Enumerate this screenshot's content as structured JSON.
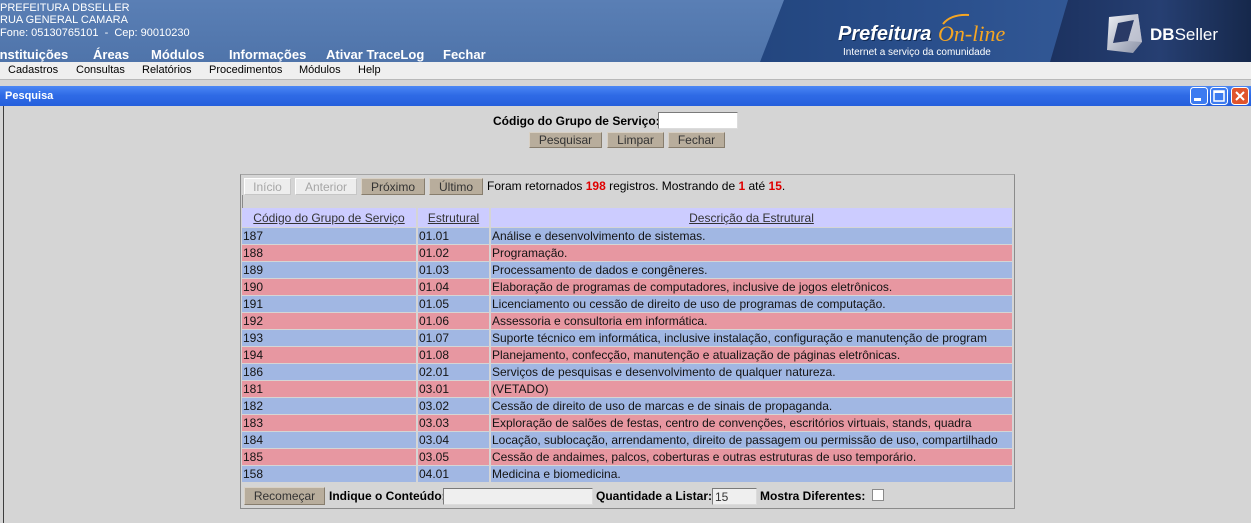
{
  "header": {
    "org_name": "PREFEITURA DBSELLER",
    "address": "RUA GENERAL CAMARA",
    "contact": "Fone: 05130765101  -  Cep: 90010230",
    "menu": [
      "Instituições",
      "Áreas",
      "Módulos",
      "Informações",
      "Ativar TraceLog",
      "Fechar"
    ],
    "banner": {
      "brand": "Prefeitura",
      "brand_accent": "On-line",
      "tagline": "Internet a serviço da comunidade"
    },
    "vendor": {
      "prefix": "DB",
      "suffix": "Seller"
    }
  },
  "menubar": [
    "Cadastros",
    "Consultas",
    "Relatórios",
    "Procedimentos",
    "Módulos",
    "Help"
  ],
  "window": {
    "title": "Pesquisa",
    "control_icons": [
      "minimize-icon",
      "maximize-icon",
      "close-icon"
    ]
  },
  "search": {
    "label": "Código do Grupo de Serviço:",
    "value": "",
    "buttons": {
      "search": "Pesquisar",
      "clear": "Limpar",
      "close": "Fechar"
    }
  },
  "results": {
    "pager": {
      "first": "Início",
      "previous": "Anterior",
      "next": "Próximo",
      "last": "Último"
    },
    "pager_disabled": [
      "first",
      "previous"
    ],
    "summary": {
      "prefix": "Foram retornados ",
      "total": "198",
      "middle": " registros. Mostrando de ",
      "from": "1",
      "to_label": " até ",
      "to": "15",
      "suffix": "."
    },
    "columns": [
      "Código do Grupo de Serviço",
      "Estrutural",
      "Descrição da Estrutural"
    ],
    "rows": [
      {
        "code": "187",
        "structural": "01.01",
        "description": "Análise e desenvolvimento de sistemas."
      },
      {
        "code": "188",
        "structural": "01.02",
        "description": "Programação."
      },
      {
        "code": "189",
        "structural": "01.03",
        "description": "Processamento de dados e congêneres."
      },
      {
        "code": "190",
        "structural": "01.04",
        "description": "Elaboração de programas de computadores, inclusive de jogos eletrônicos."
      },
      {
        "code": "191",
        "structural": "01.05",
        "description": "Licenciamento ou cessão de direito de uso de programas de computação."
      },
      {
        "code": "192",
        "structural": "01.06",
        "description": "Assessoria e consultoria em informática."
      },
      {
        "code": "193",
        "structural": "01.07",
        "description": "Suporte técnico em informática, inclusive instalação, configuração e manutenção de program"
      },
      {
        "code": "194",
        "structural": "01.08",
        "description": "Planejamento, confecção, manutenção e atualização de páginas eletrônicas."
      },
      {
        "code": "186",
        "structural": "02.01",
        "description": "Serviços de pesquisas e desenvolvimento de qualquer natureza."
      },
      {
        "code": "181",
        "structural": "03.01",
        "description": "(VETADO)"
      },
      {
        "code": "182",
        "structural": "03.02",
        "description": "Cessão de direito de uso de marcas e de sinais de propaganda."
      },
      {
        "code": "183",
        "structural": "03.03",
        "description": "Exploração de salões de festas, centro de convenções, escritórios virtuais, stands, quadra"
      },
      {
        "code": "184",
        "structural": "03.04",
        "description": "Locação, sublocação, arrendamento, direito de passagem ou permissão de uso, compartilhado"
      },
      {
        "code": "185",
        "structural": "03.05",
        "description": "Cessão de andaimes, palcos, coberturas e outras estruturas de uso temporário."
      },
      {
        "code": "158",
        "structural": "04.01",
        "description": "Medicina e biomedicina."
      }
    ]
  },
  "footer": {
    "restart": "Recomeçar",
    "filter_label": "Indique o Conteúdo:",
    "filter_value": "",
    "qty_label": "Quantidade a Listar:",
    "qty_value": "15",
    "distinct_label": "Mostra Diferentes:",
    "distinct_checked": false
  },
  "colors": {
    "header_blue": "#4f74aa",
    "banner_blue": "#2a4f8c",
    "vendor_navy": "#1c3260",
    "brand_accent": "#f6a623",
    "titlebar_blue": "#2f6be6",
    "window_bg": "#d5d5d5",
    "button_tan": "#b8ad9c",
    "header_row": "#ccccff",
    "row_blue": "#a1b7e3",
    "row_pink": "#e797a1",
    "highlight_red": "#e00000"
  }
}
